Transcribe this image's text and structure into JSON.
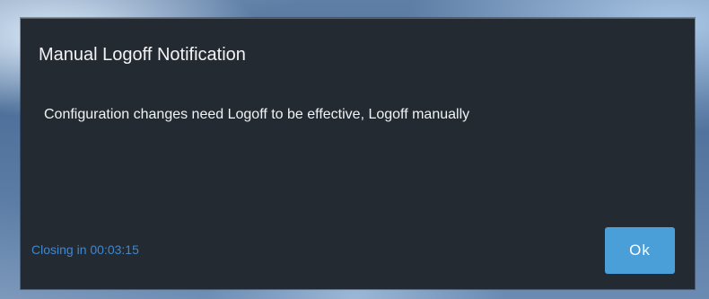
{
  "dialog": {
    "title": "Manual Logoff Notification",
    "message": "Configuration changes need Logoff to be effective, Logoff manually",
    "countdown": "Closing in 00:03:15",
    "ok_label": "Ok"
  },
  "colors": {
    "dialog_background": "#242a31",
    "accent": "#4a9fd8",
    "countdown": "#3f88cf",
    "text": "#f2f3f5"
  }
}
